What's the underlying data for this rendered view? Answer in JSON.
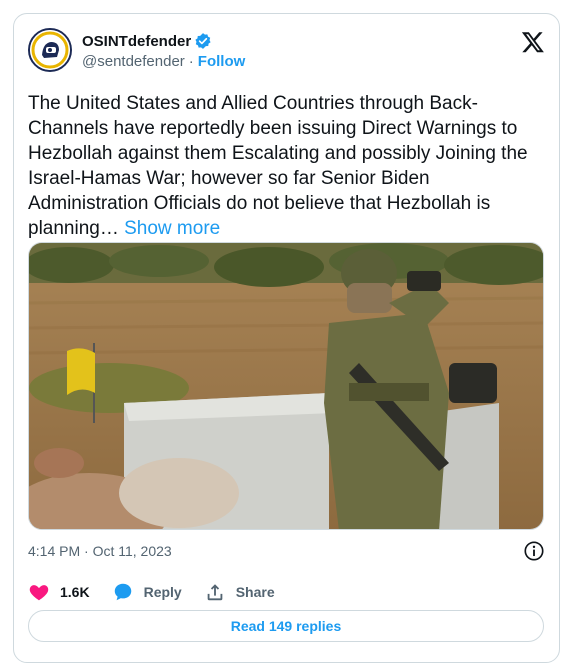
{
  "author": {
    "display_name": "OSINTdefender",
    "handle": "@sentdefender",
    "follow_label": "Follow",
    "verified_color": "#1d9bf0"
  },
  "tweet": {
    "text": "The United States and Allied Countries through Back-Channels have reportedly been issuing Direct Warnings to Hezbollah against them Escalating and possibly Joining the Israel-Hamas War; however so far Senior Biden Administration Officials do not believe that Hezbollah is planning…",
    "show_more_label": "Show more",
    "timestamp": "4:14 PM · Oct 11, 2023"
  },
  "actions": {
    "like_count": "1.6K",
    "reply_label": "Reply",
    "share_label": "Share",
    "read_replies_label": "Read 149 replies"
  },
  "colors": {
    "accent": "#1d9bf0",
    "like": "#f91880",
    "text_secondary": "#536471"
  },
  "icons": [
    "verified-badge-icon",
    "x-logo-icon",
    "info-icon",
    "heart-icon",
    "reply-bubble-icon",
    "share-icon"
  ]
}
